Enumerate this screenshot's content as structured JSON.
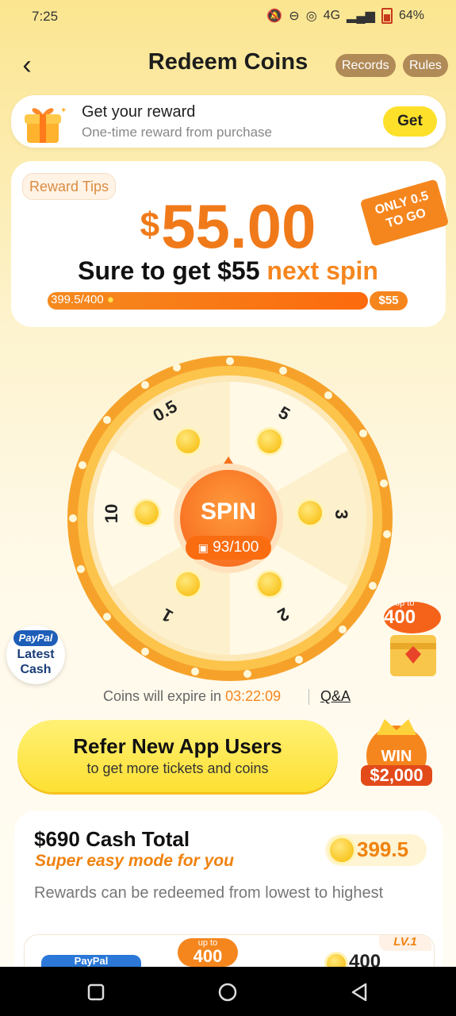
{
  "status": {
    "time": "7:25",
    "network": "4G",
    "battery": "64%"
  },
  "header": {
    "title": "Redeem Coins",
    "records": "Records",
    "rules": "Rules"
  },
  "reward_card": {
    "title": "Get your reward",
    "subtitle": "One-time reward from purchase",
    "button": "Get"
  },
  "tips_card": {
    "tag": "Reward Tips",
    "currency": "$",
    "amount": "55.00",
    "ribbon_line1": "ONLY 0.5",
    "ribbon_line2": "TO GO",
    "sure_prefix": "Sure to get $55",
    "sure_hl": "next spin",
    "progress_text": "399.5/400",
    "progress_fraction": 0.99875,
    "progress_end": "$55"
  },
  "wheel": {
    "spin_label": "SPIN",
    "tickets": "93/100",
    "segments": [
      "0.5",
      "5",
      "3",
      "2",
      "1",
      "10"
    ]
  },
  "paypal_badge": {
    "brand": "PayPal",
    "line1": "Latest",
    "line2": "Cash"
  },
  "chest": {
    "up_to": "up to",
    "amount": "400"
  },
  "expiry": {
    "prefix": "Coins will expire in",
    "time": "03:22:09",
    "qa": "Q&A"
  },
  "refer": {
    "title": "Refer New App Users",
    "subtitle": "to get more tickets and coins"
  },
  "win_badge": {
    "win": "WIN",
    "amount": "$2,000"
  },
  "cash_card": {
    "title": "$690 Cash Total",
    "subtitle": "Super easy mode for you",
    "balance": "399.5",
    "note": "Rewards can be redeemed from lowest to highest",
    "item_brand": "PayPal",
    "item_up_to": "up to",
    "item_up_amount": "400",
    "item_level": "LV.1",
    "item_coins": "400"
  }
}
